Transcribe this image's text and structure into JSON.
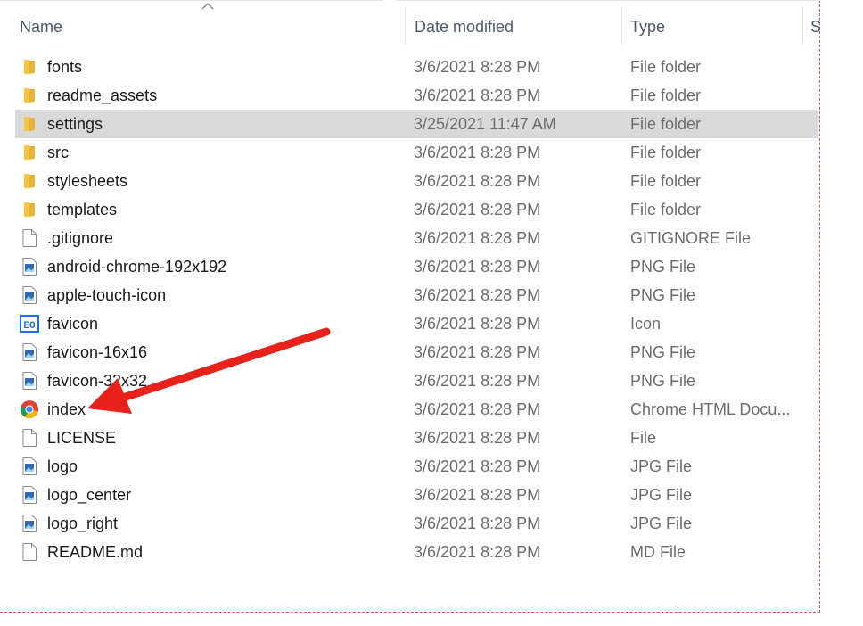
{
  "columns": {
    "name": "Name",
    "date": "Date modified",
    "type": "Type",
    "size": "S"
  },
  "files": [
    {
      "name": "fonts",
      "date": "3/6/2021 8:28 PM",
      "type": "File folder",
      "icon": "folder-icon"
    },
    {
      "name": "readme_assets",
      "date": "3/6/2021 8:28 PM",
      "type": "File folder",
      "icon": "folder-icon"
    },
    {
      "name": "settings",
      "date": "3/25/2021 11:47 AM",
      "type": "File folder",
      "icon": "folder-icon",
      "selected": true
    },
    {
      "name": "src",
      "date": "3/6/2021 8:28 PM",
      "type": "File folder",
      "icon": "folder-icon"
    },
    {
      "name": "stylesheets",
      "date": "3/6/2021 8:28 PM",
      "type": "File folder",
      "icon": "folder-icon"
    },
    {
      "name": "templates",
      "date": "3/6/2021 8:28 PM",
      "type": "File folder",
      "icon": "folder-icon"
    },
    {
      "name": ".gitignore",
      "date": "3/6/2021 8:28 PM",
      "type": "GITIGNORE File",
      "icon": "blank-file-icon"
    },
    {
      "name": "android-chrome-192x192",
      "date": "3/6/2021 8:28 PM",
      "type": "PNG File",
      "icon": "image-file-icon"
    },
    {
      "name": "apple-touch-icon",
      "date": "3/6/2021 8:28 PM",
      "type": "PNG File",
      "icon": "image-file-icon"
    },
    {
      "name": "favicon",
      "date": "3/6/2021 8:28 PM",
      "type": "Icon",
      "icon": "favicon-icon"
    },
    {
      "name": "favicon-16x16",
      "date": "3/6/2021 8:28 PM",
      "type": "PNG File",
      "icon": "image-file-icon"
    },
    {
      "name": "favicon-32x32",
      "date": "3/6/2021 8:28 PM",
      "type": "PNG File",
      "icon": "image-file-icon"
    },
    {
      "name": "index",
      "date": "3/6/2021 8:28 PM",
      "type": "Chrome HTML Docu...",
      "icon": "chrome-icon"
    },
    {
      "name": "LICENSE",
      "date": "3/6/2021 8:28 PM",
      "type": "File",
      "icon": "blank-file-icon"
    },
    {
      "name": "logo",
      "date": "3/6/2021 8:28 PM",
      "type": "JPG File",
      "icon": "image-file-icon"
    },
    {
      "name": "logo_center",
      "date": "3/6/2021 8:28 PM",
      "type": "JPG File",
      "icon": "image-file-icon"
    },
    {
      "name": "logo_right",
      "date": "3/6/2021 8:28 PM",
      "type": "JPG File",
      "icon": "image-file-icon"
    },
    {
      "name": "README.md",
      "date": "3/6/2021 8:28 PM",
      "type": "MD File",
      "icon": "blank-file-icon"
    }
  ],
  "favicon_glyph": "EO",
  "colors": {
    "annotation_arrow": "#e8211b",
    "selected_row": "#d9d9d9",
    "folder": "#f5c542"
  }
}
